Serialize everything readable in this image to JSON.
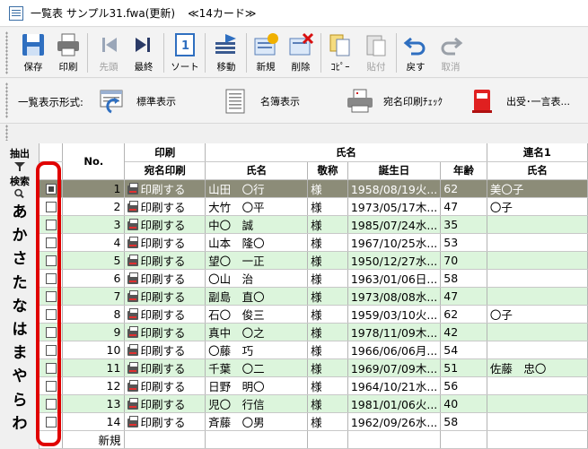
{
  "window": {
    "title": "一覧表 サンプル31.fwa(更新)",
    "card_count": "≪14カード≫"
  },
  "toolbar": {
    "buttons": [
      {
        "label": "保存",
        "icon": "save-icon",
        "enabled": true
      },
      {
        "label": "印刷",
        "icon": "printer-icon",
        "enabled": true
      },
      {
        "label": "先頭",
        "icon": "first-icon",
        "enabled": false
      },
      {
        "label": "最終",
        "icon": "last-icon",
        "enabled": true
      },
      {
        "label": "ソート",
        "icon": "sort-icon",
        "enabled": true
      },
      {
        "label": "移動",
        "icon": "move-icon",
        "enabled": true
      },
      {
        "label": "新規",
        "icon": "new-icon",
        "enabled": true
      },
      {
        "label": "削除",
        "icon": "delete-icon",
        "enabled": true
      },
      {
        "label": "ｺﾋﾟｰ",
        "icon": "copy-icon",
        "enabled": true
      },
      {
        "label": "貼付",
        "icon": "paste-icon",
        "enabled": false
      },
      {
        "label": "戻す",
        "icon": "undo-icon",
        "enabled": true
      },
      {
        "label": "取消",
        "icon": "redo-icon",
        "enabled": false
      }
    ]
  },
  "format_bar": {
    "label": "一覧表示形式:",
    "options": [
      {
        "label": "標準表示",
        "icon": "standard-view-icon"
      },
      {
        "label": "名簿表示",
        "icon": "roster-view-icon"
      },
      {
        "label": "宛名印刷ﾁｪｯｸ",
        "icon": "address-print-check-icon"
      },
      {
        "label": "出受･一言表...",
        "icon": "mail-record-icon"
      }
    ]
  },
  "left_panel": {
    "extract_label": "抽出",
    "search_label": "検索",
    "kana": [
      "あ",
      "か",
      "さ",
      "た",
      "な",
      "は",
      "ま",
      "や",
      "ら",
      "わ"
    ]
  },
  "grid": {
    "header_top": {
      "print": "印刷",
      "name": "氏名",
      "joint": "連名1"
    },
    "header_sub": {
      "no": "No.",
      "address_print": "宛名印刷",
      "name": "氏名",
      "honorific": "敬称",
      "birthday": "誕生日",
      "age": "年齢",
      "joint_name": "氏名"
    },
    "new_row_label": "新規",
    "rows": [
      {
        "checked": true,
        "no": "1",
        "print": "印刷する",
        "name": "山田　〇行",
        "honorific": "様",
        "birthday": "1958/08/19火...",
        "age": "62",
        "joint": "美〇子"
      },
      {
        "checked": false,
        "no": "2",
        "print": "印刷する",
        "name": "大竹　〇平",
        "honorific": "様",
        "birthday": "1973/05/17木...",
        "age": "47",
        "joint": "〇子"
      },
      {
        "checked": false,
        "no": "3",
        "print": "印刷する",
        "name": "中〇　誠",
        "honorific": "様",
        "birthday": "1985/07/24水...",
        "age": "35",
        "joint": ""
      },
      {
        "checked": false,
        "no": "4",
        "print": "印刷する",
        "name": "山本　隆〇",
        "honorific": "様",
        "birthday": "1967/10/25水...",
        "age": "53",
        "joint": ""
      },
      {
        "checked": false,
        "no": "5",
        "print": "印刷する",
        "name": "望〇　一正",
        "honorific": "様",
        "birthday": "1950/12/27水...",
        "age": "70",
        "joint": ""
      },
      {
        "checked": false,
        "no": "6",
        "print": "印刷する",
        "name": "〇山　治",
        "honorific": "様",
        "birthday": "1963/01/06日...",
        "age": "58",
        "joint": ""
      },
      {
        "checked": false,
        "no": "7",
        "print": "印刷する",
        "name": "副島　直〇",
        "honorific": "様",
        "birthday": "1973/08/08水...",
        "age": "47",
        "joint": ""
      },
      {
        "checked": false,
        "no": "8",
        "print": "印刷する",
        "name": "石〇　俊三",
        "honorific": "様",
        "birthday": "1959/03/10火...",
        "age": "62",
        "joint": "〇子"
      },
      {
        "checked": false,
        "no": "9",
        "print": "印刷する",
        "name": "真中　〇之",
        "honorific": "様",
        "birthday": "1978/11/09木...",
        "age": "42",
        "joint": ""
      },
      {
        "checked": false,
        "no": "10",
        "print": "印刷する",
        "name": "〇藤　巧",
        "honorific": "様",
        "birthday": "1966/06/06月...",
        "age": "54",
        "joint": ""
      },
      {
        "checked": false,
        "no": "11",
        "print": "印刷する",
        "name": "千葉　〇二",
        "honorific": "様",
        "birthday": "1969/07/09木...",
        "age": "51",
        "joint": "佐藤　忠〇"
      },
      {
        "checked": false,
        "no": "12",
        "print": "印刷する",
        "name": "日野　明〇",
        "honorific": "様",
        "birthday": "1964/10/21水...",
        "age": "56",
        "joint": ""
      },
      {
        "checked": false,
        "no": "13",
        "print": "印刷する",
        "name": "児〇　行信",
        "honorific": "様",
        "birthday": "1981/01/06火...",
        "age": "40",
        "joint": ""
      },
      {
        "checked": false,
        "no": "14",
        "print": "印刷する",
        "name": "斉藤　〇男",
        "honorific": "様",
        "birthday": "1962/09/26水...",
        "age": "58",
        "joint": ""
      }
    ]
  },
  "colors": {
    "row_green": "#dcf5dc",
    "selected_row": "#8c8c78",
    "highlight_red": "#e00000"
  }
}
